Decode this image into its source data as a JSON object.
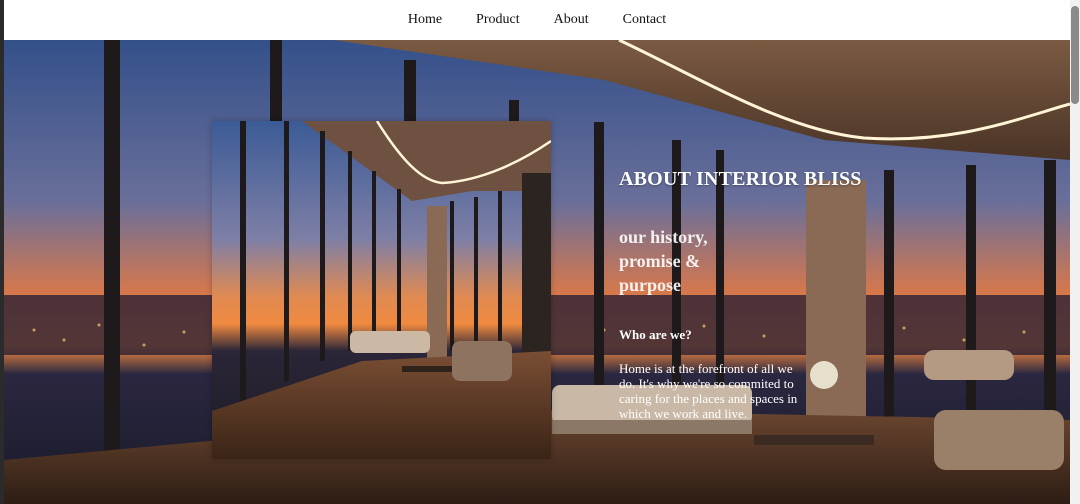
{
  "nav": {
    "items": [
      {
        "label": "Home"
      },
      {
        "label": "Product"
      },
      {
        "label": "About"
      },
      {
        "label": "Contact"
      }
    ]
  },
  "about": {
    "title": "ABOUT INTERIOR BLISS",
    "subtitle": "our history, promise & purpose",
    "who_heading": "Who are we?",
    "who_body": "Home is at the forefront of all we do. It's why we're so commited to caring for the places and spaces in which we work and live."
  },
  "colors": {
    "nav_bg": "#ffffff",
    "text": "#ffffff",
    "sky_top": "#3e5a8c",
    "sunset": "#f07a3a",
    "floor": "#5a3a26"
  },
  "images": {
    "hero": "penthouse-living-room-sunset-photo",
    "inset": "penthouse-interior-photo"
  }
}
